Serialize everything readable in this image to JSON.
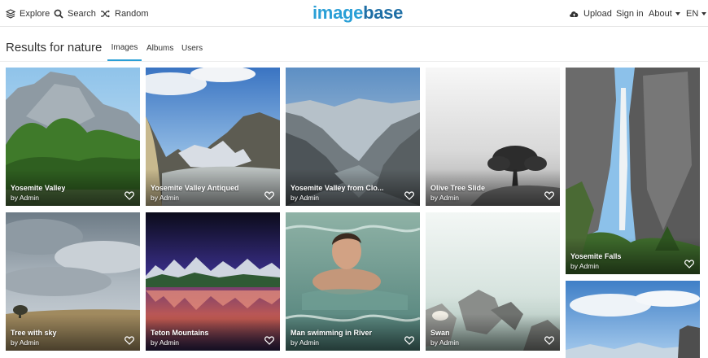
{
  "nav": {
    "explore": "Explore",
    "search": "Search",
    "random": "Random",
    "logo_part1": "image",
    "logo_part2": "base",
    "upload": "Upload",
    "signin": "Sign in",
    "about": "About",
    "language": "EN"
  },
  "results": {
    "title": "Results for nature",
    "tabs": [
      "Images",
      "Albums",
      "Users"
    ],
    "active_tab": "Images"
  },
  "images": [
    {
      "title": "Yosemite Valley",
      "author": "by Admin",
      "icon": "heart-icon"
    },
    {
      "title": "Yosemite Valley Antiqued",
      "author": "by Admin",
      "icon": "heart-icon"
    },
    {
      "title": "Yosemite Valley from Clo...",
      "author": "by Admin",
      "icon": "heart-icon"
    },
    {
      "title": "Olive Tree Slide",
      "author": "by Admin",
      "icon": "heart-icon"
    },
    {
      "title": "Yosemite Falls",
      "author": "by Admin",
      "icon": "heart-icon"
    },
    {
      "title": "Tree with sky",
      "author": "by Admin",
      "icon": "heart-icon"
    },
    {
      "title": "Teton Mountains",
      "author": "by Admin",
      "icon": "heart-icon"
    },
    {
      "title": "Man swimming in River",
      "author": "by Admin",
      "icon": "heart-icon"
    },
    {
      "title": "Swan",
      "author": "by Admin",
      "icon": "heart-icon"
    }
  ],
  "colors": {
    "accent": "#2a9fd6",
    "logo_dark": "#1f6fa6"
  }
}
